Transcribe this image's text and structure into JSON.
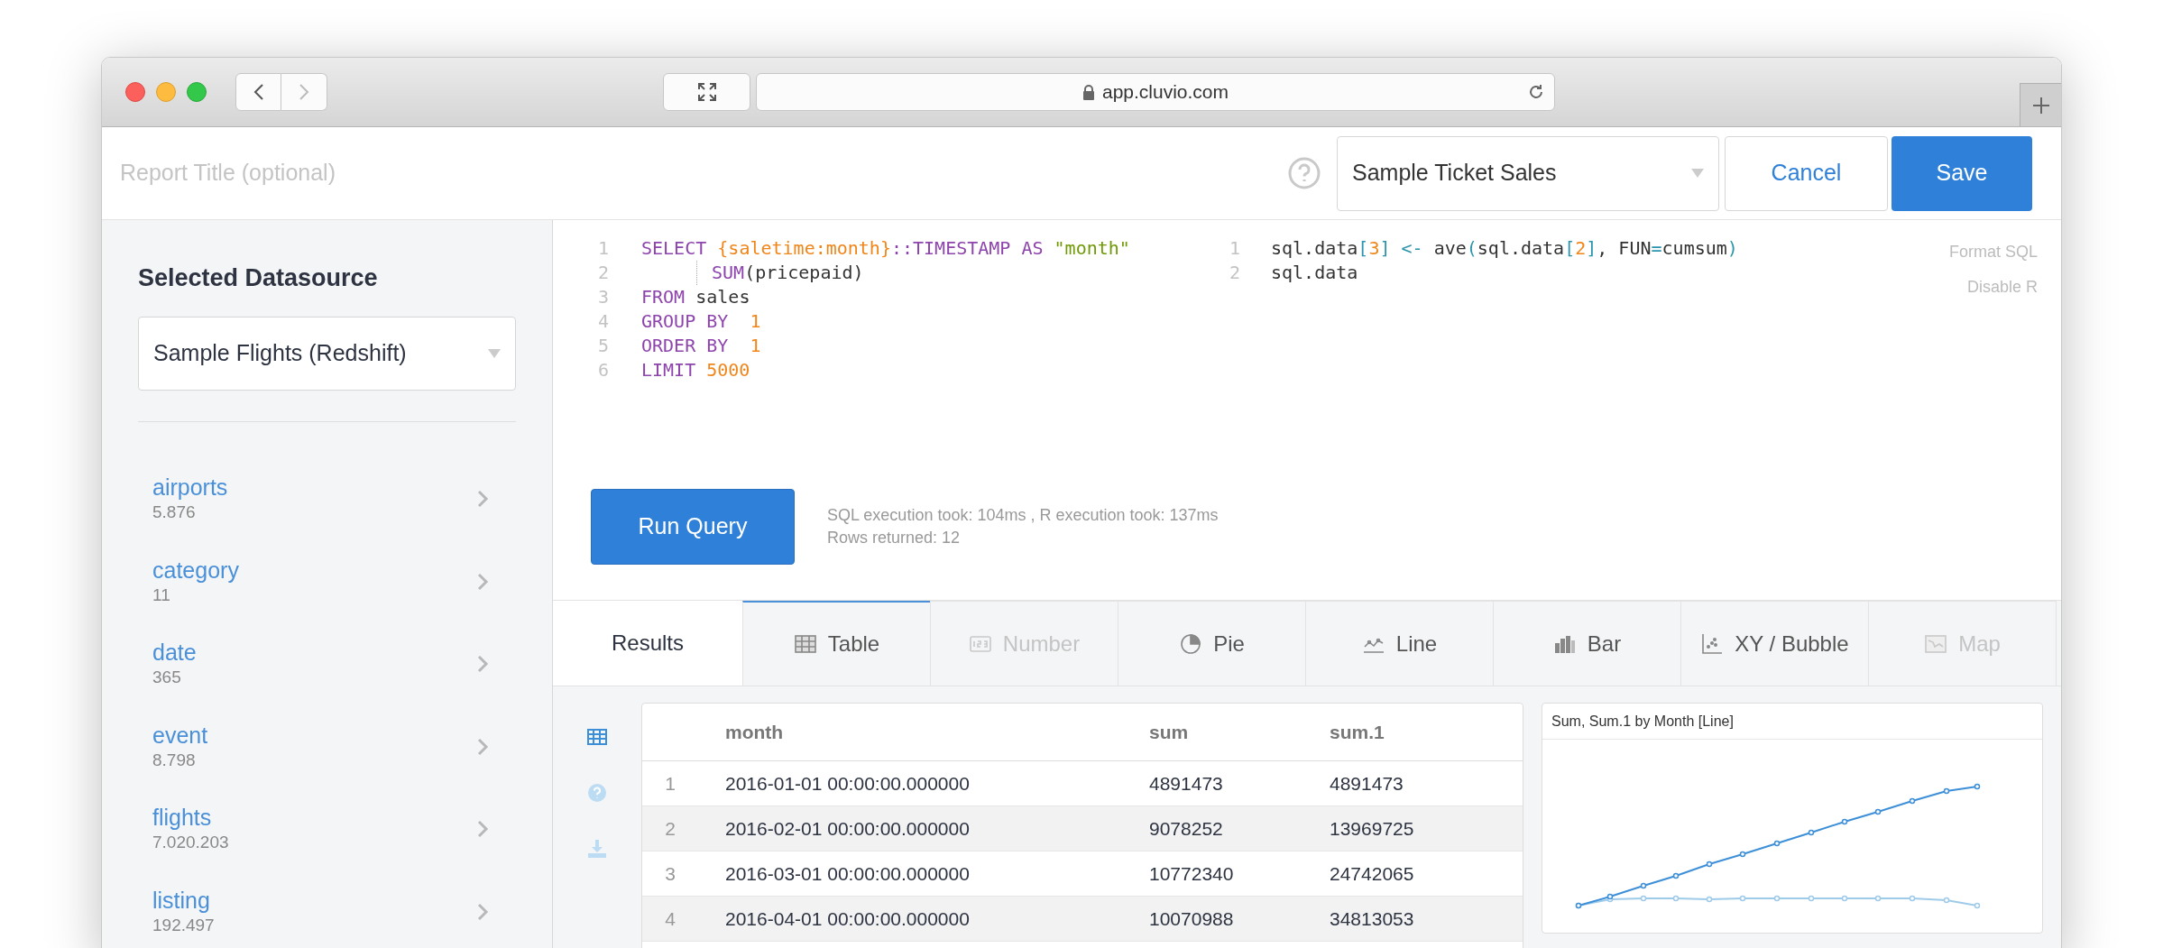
{
  "browser": {
    "url": "app.cluvio.com"
  },
  "header": {
    "title_placeholder": "Report Title (optional)",
    "report_select": "Sample Ticket Sales",
    "cancel": "Cancel",
    "save": "Save"
  },
  "sidebar": {
    "heading": "Selected Datasource",
    "datasource": "Sample Flights (Redshift)",
    "tables": [
      {
        "name": "airports",
        "count": "5.876"
      },
      {
        "name": "category",
        "count": "11"
      },
      {
        "name": "date",
        "count": "365"
      },
      {
        "name": "event",
        "count": "8.798"
      },
      {
        "name": "flights",
        "count": "7.020.203"
      },
      {
        "name": "listing",
        "count": "192.497"
      }
    ]
  },
  "sql_editor": {
    "lines": [
      {
        "number": "1",
        "indent": false,
        "tokens": [
          {
            "kind": "kw",
            "text": "SELECT "
          },
          {
            "kind": "num",
            "text": "{saletime:month}"
          },
          {
            "kind": "kw",
            "text": "::TIMESTAMP AS "
          },
          {
            "kind": "str",
            "text": "\"month\""
          }
        ]
      },
      {
        "number": "2",
        "indent": true,
        "tokens": [
          {
            "kind": "kw",
            "text": "SUM"
          },
          {
            "kind": "plain",
            "text": "(pricepaid)"
          }
        ]
      },
      {
        "number": "3",
        "indent": false,
        "tokens": [
          {
            "kind": "kw",
            "text": "FROM "
          },
          {
            "kind": "plain",
            "text": "sales"
          }
        ]
      },
      {
        "number": "4",
        "indent": false,
        "tokens": [
          {
            "kind": "kw",
            "text": "GROUP BY  "
          },
          {
            "kind": "num",
            "text": "1"
          }
        ]
      },
      {
        "number": "5",
        "indent": false,
        "tokens": [
          {
            "kind": "kw",
            "text": "ORDER BY  "
          },
          {
            "kind": "num",
            "text": "1"
          }
        ]
      },
      {
        "number": "6",
        "indent": false,
        "tokens": [
          {
            "kind": "kw",
            "text": "LIMIT "
          },
          {
            "kind": "num",
            "text": "5000"
          }
        ]
      }
    ]
  },
  "r_editor": {
    "lines": [
      {
        "number": "1",
        "tokens": [
          {
            "kind": "plain",
            "text": "sql.data"
          },
          {
            "kind": "punct",
            "text": "["
          },
          {
            "kind": "num",
            "text": "3"
          },
          {
            "kind": "punct",
            "text": "]"
          },
          {
            "kind": "punct",
            "text": " <-"
          },
          {
            "kind": "plain",
            "text": " ave"
          },
          {
            "kind": "punct",
            "text": "("
          },
          {
            "kind": "plain",
            "text": "sql.data"
          },
          {
            "kind": "punct",
            "text": "["
          },
          {
            "kind": "num",
            "text": "2"
          },
          {
            "kind": "punct",
            "text": "]"
          },
          {
            "kind": "plain",
            "text": ", FUN"
          },
          {
            "kind": "punct",
            "text": "="
          },
          {
            "kind": "plain",
            "text": "cumsum"
          },
          {
            "kind": "punct",
            "text": ")"
          }
        ]
      },
      {
        "number": "2",
        "tokens": [
          {
            "kind": "plain",
            "text": "sql.data"
          }
        ]
      }
    ]
  },
  "editor_links": [
    "Format SQL",
    "Disable R"
  ],
  "run_button": "Run Query",
  "stats": [
    "SQL execution took: 104ms , R execution took: 137ms",
    "Rows returned: 12"
  ],
  "results_label": "Results",
  "tabs": [
    {
      "kind": "table",
      "label": "Table",
      "selected": true,
      "disabled": false
    },
    {
      "kind": "number",
      "label": "Number",
      "selected": false,
      "disabled": true
    },
    {
      "kind": "pie",
      "label": "Pie",
      "selected": false,
      "disabled": false
    },
    {
      "kind": "line",
      "label": "Line",
      "selected": false,
      "disabled": false
    },
    {
      "kind": "bar",
      "label": "Bar",
      "selected": false,
      "disabled": false
    },
    {
      "kind": "xy",
      "label": "XY / Bubble",
      "selected": false,
      "disabled": false
    },
    {
      "kind": "map",
      "label": "Map",
      "selected": false,
      "disabled": true
    }
  ],
  "side_tools": [
    {
      "kind": "table",
      "selected": true
    },
    {
      "kind": "help",
      "selected": false
    },
    {
      "kind": "download",
      "selected": false
    }
  ],
  "table": {
    "columns": [
      "month",
      "sum",
      "sum.1"
    ],
    "rows": [
      {
        "index": "1",
        "cells": [
          "2016-01-01 00:00:00.000000",
          "4891473",
          "4891473"
        ]
      },
      {
        "index": "2",
        "cells": [
          "2016-02-01 00:00:00.000000",
          "9078252",
          "13969725"
        ]
      },
      {
        "index": "3",
        "cells": [
          "2016-03-01 00:00:00.000000",
          "10772340",
          "24742065"
        ]
      },
      {
        "index": "4",
        "cells": [
          "2016-04-01 00:00:00.000000",
          "10070988",
          "34813053"
        ]
      }
    ]
  },
  "chart_preview": {
    "title": "Sum, Sum.1 by Month [Line]"
  }
}
